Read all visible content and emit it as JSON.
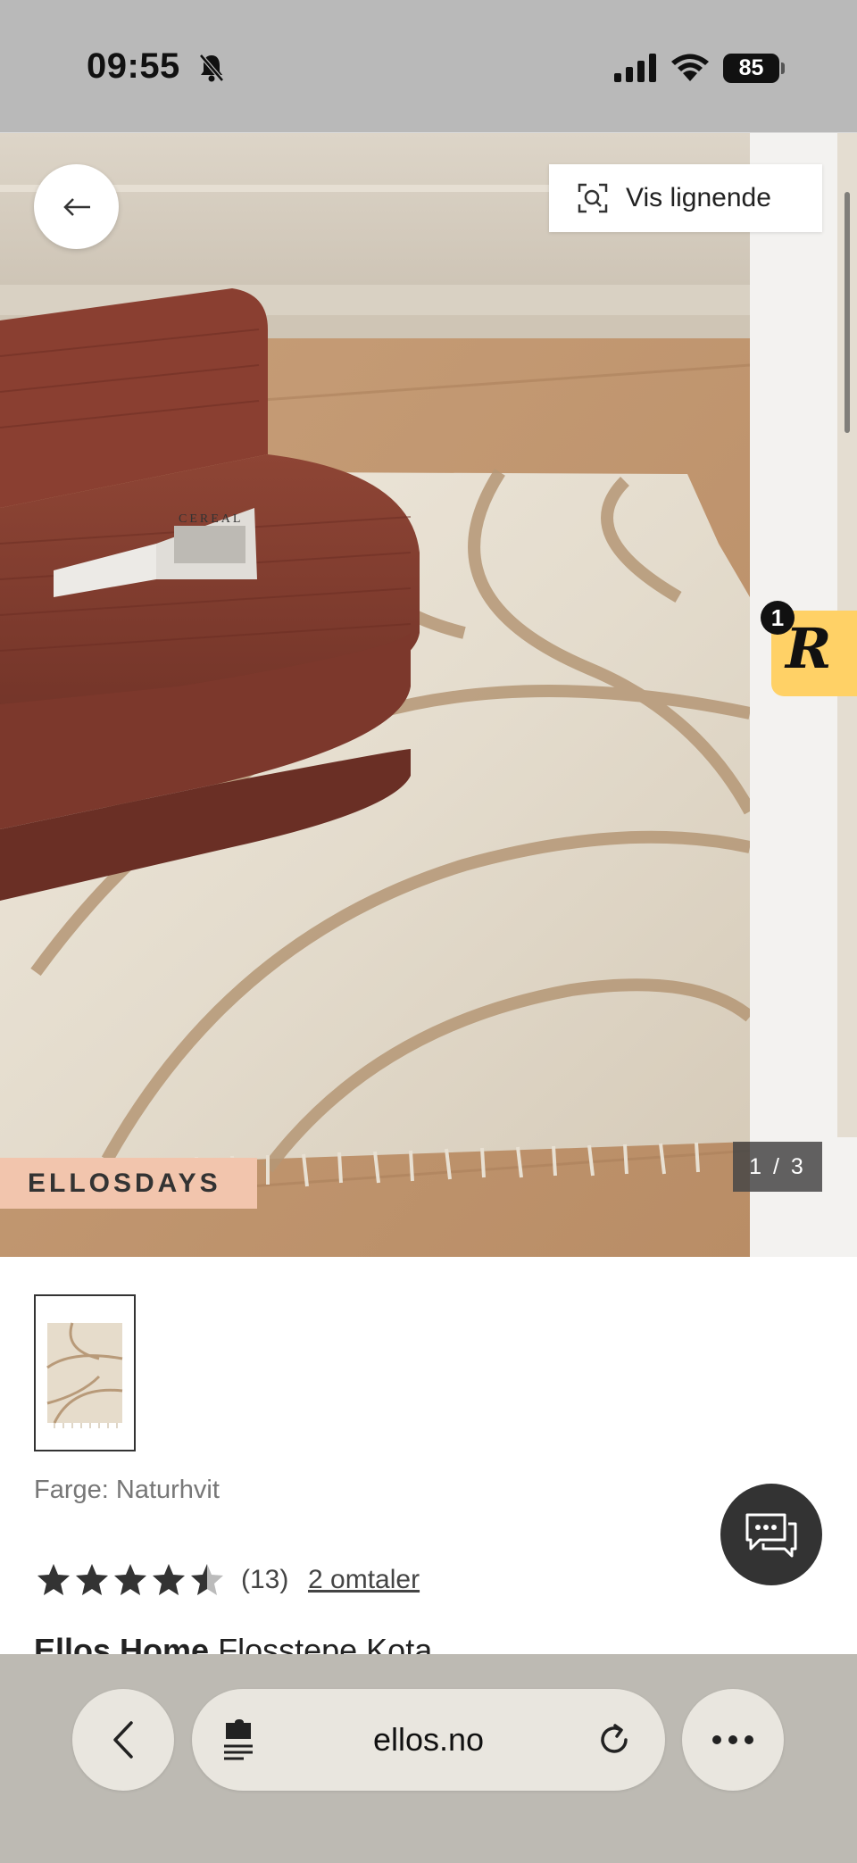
{
  "status_bar": {
    "time": "09:55",
    "battery": "85",
    "icons": [
      "bell-slash-icon",
      "signal-icon",
      "wifi-icon",
      "battery-icon"
    ]
  },
  "gallery": {
    "similar_label": "Vis lignende",
    "sale_tag": "ELLOSDAYS",
    "counter": "1 / 3",
    "badge_count": "1",
    "badge_letter": "R"
  },
  "product": {
    "color_label": "Farge: Naturhvit",
    "rating_value": 4.5,
    "rating_count": "(13)",
    "reviews_link": "2 omtaler",
    "brand": "Ellos Home",
    "name": "Flosstepe Kota"
  },
  "browser": {
    "url": "ellos.no"
  },
  "colors": {
    "sale_tag": "#f2c5ad",
    "badge": "#ffd166",
    "statusbar": "#b9b9b9",
    "browserbar": "#bdbab3"
  }
}
